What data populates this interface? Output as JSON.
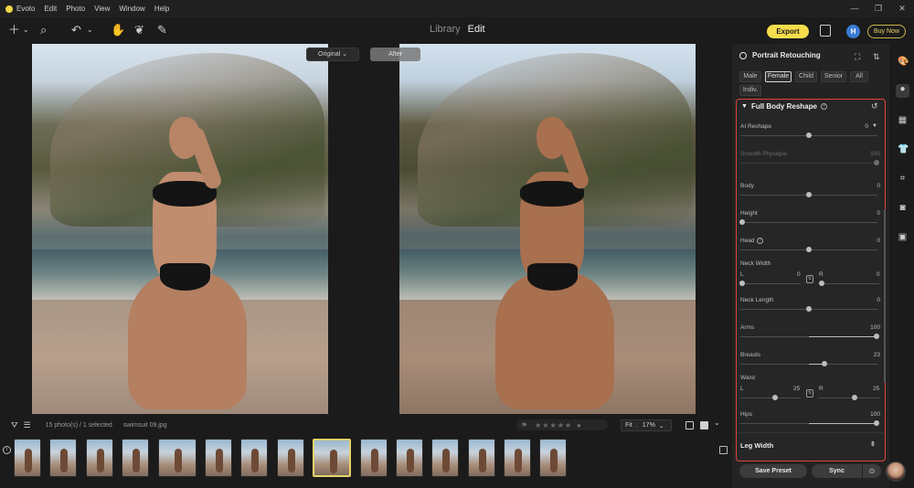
{
  "menubar": {
    "app_name": "Evoto",
    "items": [
      "Edit",
      "Photo",
      "View",
      "Window",
      "Help"
    ],
    "window_controls": [
      "—",
      "❐",
      "✕"
    ]
  },
  "toolbar": {
    "tabs": [
      {
        "label": "Library"
      },
      {
        "label": "Edit",
        "active": true
      }
    ],
    "export_label": "Export",
    "user_initial": "H",
    "buy_now_label": "Buy Now"
  },
  "canvas": {
    "compare_mode": "Original",
    "after_label": "After"
  },
  "filmstrip": {
    "count_text": "15 photo(s) / 1 selected",
    "current_file": "swimsuit 09.jpg",
    "fit_label": "Fit",
    "zoom_label": "17%",
    "thumbnail_count": 15,
    "selected_index": 8
  },
  "panel": {
    "title": "Portrait Retouching",
    "chips": [
      {
        "label": "Male"
      },
      {
        "label": "Female",
        "active": true
      },
      {
        "label": "Child"
      },
      {
        "label": "Senior"
      },
      {
        "label": "All"
      },
      {
        "label": "Indiv."
      }
    ],
    "section_title": "Full Body Reshape",
    "ai_reshape": {
      "label": "AI Reshape",
      "value": "0"
    },
    "smooth_physique": {
      "label": "Smooth Physique",
      "value": "100"
    },
    "body": {
      "label": "Body",
      "value": "0"
    },
    "height": {
      "label": "Height",
      "value": "0"
    },
    "head": {
      "label": "Head",
      "value": "0"
    },
    "neck_width": {
      "label": "Neck Width",
      "left_label": "L",
      "left_value": "0",
      "right_label": "R",
      "right_value": "0"
    },
    "neck_length": {
      "label": "Neck Length",
      "value": "0"
    },
    "arms": {
      "label": "Arms",
      "value": "100"
    },
    "breasts": {
      "label": "Breasts",
      "value": "23"
    },
    "waist": {
      "label": "Waist",
      "left_label": "L",
      "left_value": "25",
      "right_label": "R",
      "right_value": "25"
    },
    "hips": {
      "label": "Hips",
      "value": "100"
    },
    "leg_width": {
      "label": "Leg Width"
    },
    "save_preset_label": "Save Preset",
    "sync_label": "Sync"
  }
}
